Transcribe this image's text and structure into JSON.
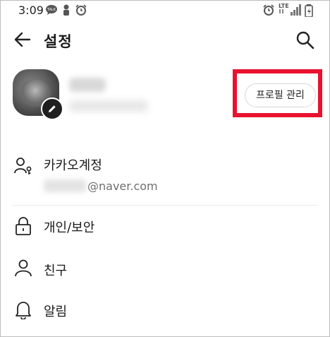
{
  "status_bar": {
    "time": "3:09",
    "network": "LTE",
    "left_icons": [
      "chat-bubble-icon",
      "person-icon",
      "alarm-icon"
    ],
    "right_icons": [
      "alarm-icon",
      "lte-signal-icon",
      "signal-icon",
      "battery-icon"
    ]
  },
  "header": {
    "title": "설정",
    "back_icon": "arrow-left-icon",
    "search_icon": "search-icon"
  },
  "profile": {
    "manage_button_label": "프로필 관리",
    "highlight_color": "#e8122f",
    "edit_icon": "pencil-icon"
  },
  "menu": [
    {
      "label": "카카오계정",
      "icon": "account-key-icon",
      "sub": "@naver.com"
    },
    {
      "label": "개인/보안",
      "icon": "lock-icon"
    },
    {
      "label": "친구",
      "icon": "person-icon"
    },
    {
      "label": "알림",
      "icon": "bell-icon"
    }
  ]
}
